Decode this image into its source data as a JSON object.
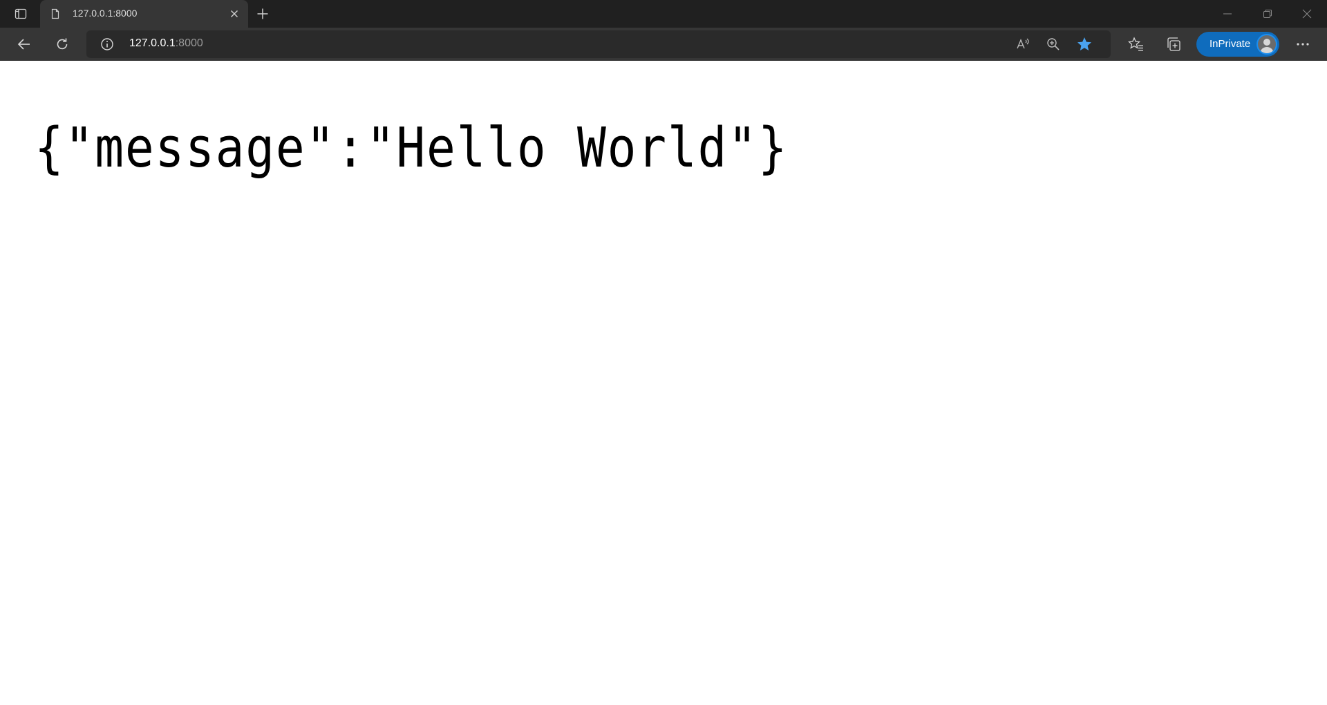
{
  "browser": {
    "tab": {
      "title": "127.0.0.1:8000",
      "favicon_icon": "document-icon"
    },
    "address_bar": {
      "host": "127.0.0.1",
      "port": ":8000"
    },
    "profile": {
      "label": "InPrivate",
      "accent_color": "#0f6cbd"
    },
    "favorite_star_color": "#4aa3f0",
    "icons": {
      "tab_actions": "tab-actions-icon",
      "new_tab": "plus-icon",
      "back": "back-arrow-icon",
      "refresh": "refresh-icon",
      "site_info": "info-icon",
      "read_aloud": "read-aloud-icon",
      "zoom": "zoom-icon",
      "favorite": "star-icon",
      "favorites": "favorites-icon",
      "collections": "collections-icon",
      "more": "more-icon",
      "minimize": "minimize-icon",
      "restore": "restore-icon",
      "close": "close-icon"
    }
  },
  "page": {
    "body_text": "{\"message\":\"Hello World\"}"
  }
}
